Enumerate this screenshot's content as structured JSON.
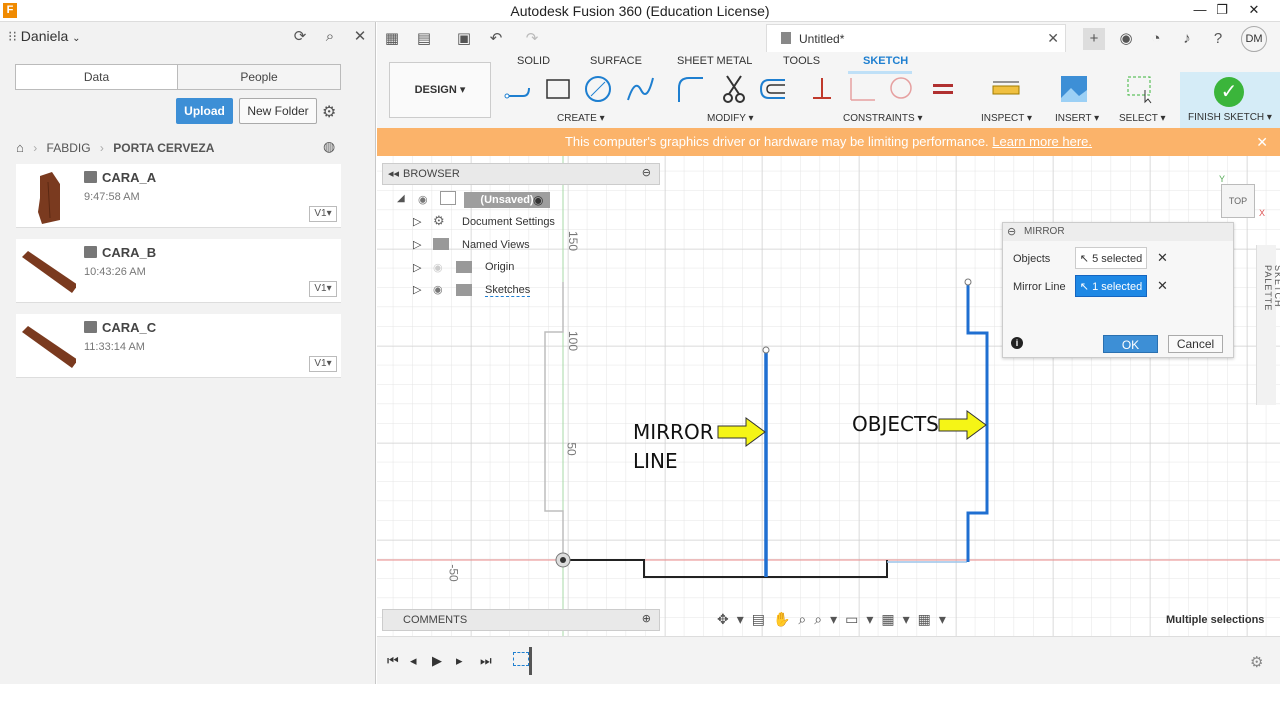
{
  "window": {
    "title": "Autodesk Fusion 360 (Education License)",
    "app_icon": "F"
  },
  "left_panel": {
    "user": "Daniela",
    "tabs": [
      "Data",
      "People"
    ],
    "upload_label": "Upload",
    "new_folder_label": "New Folder",
    "breadcrumb": [
      "FABDIG",
      "PORTA CERVEZA"
    ],
    "files": [
      {
        "name": "CARA_A",
        "time": "9:47:58 AM",
        "version": "V1"
      },
      {
        "name": "CARA_B",
        "time": "10:43:26 AM",
        "version": "V1"
      },
      {
        "name": "CARA_C",
        "time": "11:33:14 AM",
        "version": "V1"
      }
    ]
  },
  "toolbar": {
    "document_tab": "Untitled*",
    "workspace": "DESIGN",
    "tabs": [
      "SOLID",
      "SURFACE",
      "SHEET METAL",
      "TOOLS",
      "SKETCH"
    ],
    "groups": [
      "CREATE",
      "MODIFY",
      "CONSTRAINTS",
      "INSPECT",
      "INSERT",
      "SELECT"
    ],
    "finish_label": "FINISH SKETCH",
    "user_initials": "DM"
  },
  "warning": {
    "text": "This computer's graphics driver or hardware may be limiting performance.",
    "link": "Learn more here."
  },
  "browser": {
    "title": "BROWSER",
    "root": "(Unsaved)",
    "items": [
      "Document Settings",
      "Named Views",
      "Origin",
      "Sketches"
    ]
  },
  "comments": "COMMENTS",
  "viewcube": "TOP",
  "axis_labels": [
    "150",
    "100",
    "50",
    "-50"
  ],
  "annotations": {
    "mirror_line_1": "MIRROR",
    "mirror_line_2": "LINE",
    "objects": "OBJECTS"
  },
  "mirror_dialog": {
    "title": "MIRROR",
    "objects_label": "Objects",
    "objects_value": "5 selected",
    "mirror_line_label": "Mirror Line",
    "mirror_line_value": "1 selected",
    "ok": "OK",
    "cancel": "Cancel"
  },
  "sketch_palette": "SKETCH PALETTE",
  "status": "Multiple selections",
  "colors": {
    "accent": "#1e7fd0",
    "warning": "#fbb36a",
    "selected_line": "#1f6fd1"
  }
}
